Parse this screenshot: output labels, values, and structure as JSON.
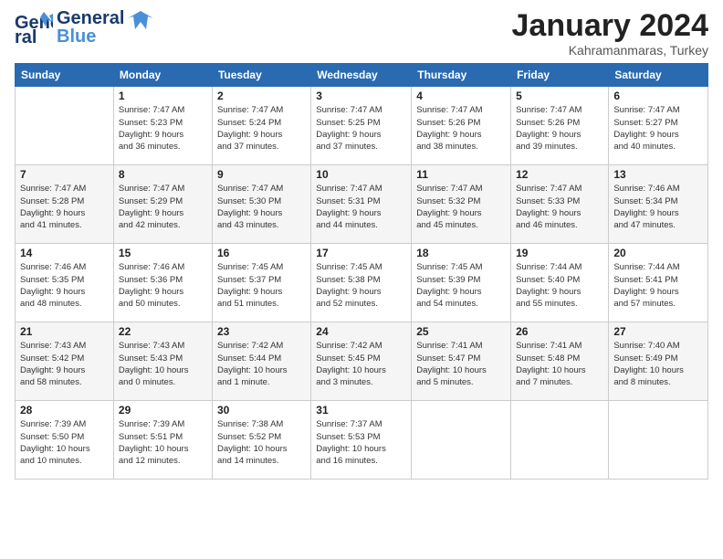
{
  "header": {
    "logo": {
      "general": "General",
      "blue": "Blue"
    },
    "title": "January 2024",
    "location": "Kahramanmaras, Turkey"
  },
  "weekdays": [
    "Sunday",
    "Monday",
    "Tuesday",
    "Wednesday",
    "Thursday",
    "Friday",
    "Saturday"
  ],
  "weeks": [
    [
      {
        "day": "",
        "info": ""
      },
      {
        "day": "1",
        "info": "Sunrise: 7:47 AM\nSunset: 5:23 PM\nDaylight: 9 hours\nand 36 minutes."
      },
      {
        "day": "2",
        "info": "Sunrise: 7:47 AM\nSunset: 5:24 PM\nDaylight: 9 hours\nand 37 minutes."
      },
      {
        "day": "3",
        "info": "Sunrise: 7:47 AM\nSunset: 5:25 PM\nDaylight: 9 hours\nand 37 minutes."
      },
      {
        "day": "4",
        "info": "Sunrise: 7:47 AM\nSunset: 5:26 PM\nDaylight: 9 hours\nand 38 minutes."
      },
      {
        "day": "5",
        "info": "Sunrise: 7:47 AM\nSunset: 5:26 PM\nDaylight: 9 hours\nand 39 minutes."
      },
      {
        "day": "6",
        "info": "Sunrise: 7:47 AM\nSunset: 5:27 PM\nDaylight: 9 hours\nand 40 minutes."
      }
    ],
    [
      {
        "day": "7",
        "info": "Sunrise: 7:47 AM\nSunset: 5:28 PM\nDaylight: 9 hours\nand 41 minutes."
      },
      {
        "day": "8",
        "info": "Sunrise: 7:47 AM\nSunset: 5:29 PM\nDaylight: 9 hours\nand 42 minutes."
      },
      {
        "day": "9",
        "info": "Sunrise: 7:47 AM\nSunset: 5:30 PM\nDaylight: 9 hours\nand 43 minutes."
      },
      {
        "day": "10",
        "info": "Sunrise: 7:47 AM\nSunset: 5:31 PM\nDaylight: 9 hours\nand 44 minutes."
      },
      {
        "day": "11",
        "info": "Sunrise: 7:47 AM\nSunset: 5:32 PM\nDaylight: 9 hours\nand 45 minutes."
      },
      {
        "day": "12",
        "info": "Sunrise: 7:47 AM\nSunset: 5:33 PM\nDaylight: 9 hours\nand 46 minutes."
      },
      {
        "day": "13",
        "info": "Sunrise: 7:46 AM\nSunset: 5:34 PM\nDaylight: 9 hours\nand 47 minutes."
      }
    ],
    [
      {
        "day": "14",
        "info": "Sunrise: 7:46 AM\nSunset: 5:35 PM\nDaylight: 9 hours\nand 48 minutes."
      },
      {
        "day": "15",
        "info": "Sunrise: 7:46 AM\nSunset: 5:36 PM\nDaylight: 9 hours\nand 50 minutes."
      },
      {
        "day": "16",
        "info": "Sunrise: 7:45 AM\nSunset: 5:37 PM\nDaylight: 9 hours\nand 51 minutes."
      },
      {
        "day": "17",
        "info": "Sunrise: 7:45 AM\nSunset: 5:38 PM\nDaylight: 9 hours\nand 52 minutes."
      },
      {
        "day": "18",
        "info": "Sunrise: 7:45 AM\nSunset: 5:39 PM\nDaylight: 9 hours\nand 54 minutes."
      },
      {
        "day": "19",
        "info": "Sunrise: 7:44 AM\nSunset: 5:40 PM\nDaylight: 9 hours\nand 55 minutes."
      },
      {
        "day": "20",
        "info": "Sunrise: 7:44 AM\nSunset: 5:41 PM\nDaylight: 9 hours\nand 57 minutes."
      }
    ],
    [
      {
        "day": "21",
        "info": "Sunrise: 7:43 AM\nSunset: 5:42 PM\nDaylight: 9 hours\nand 58 minutes."
      },
      {
        "day": "22",
        "info": "Sunrise: 7:43 AM\nSunset: 5:43 PM\nDaylight: 10 hours\nand 0 minutes."
      },
      {
        "day": "23",
        "info": "Sunrise: 7:42 AM\nSunset: 5:44 PM\nDaylight: 10 hours\nand 1 minute."
      },
      {
        "day": "24",
        "info": "Sunrise: 7:42 AM\nSunset: 5:45 PM\nDaylight: 10 hours\nand 3 minutes."
      },
      {
        "day": "25",
        "info": "Sunrise: 7:41 AM\nSunset: 5:47 PM\nDaylight: 10 hours\nand 5 minutes."
      },
      {
        "day": "26",
        "info": "Sunrise: 7:41 AM\nSunset: 5:48 PM\nDaylight: 10 hours\nand 7 minutes."
      },
      {
        "day": "27",
        "info": "Sunrise: 7:40 AM\nSunset: 5:49 PM\nDaylight: 10 hours\nand 8 minutes."
      }
    ],
    [
      {
        "day": "28",
        "info": "Sunrise: 7:39 AM\nSunset: 5:50 PM\nDaylight: 10 hours\nand 10 minutes."
      },
      {
        "day": "29",
        "info": "Sunrise: 7:39 AM\nSunset: 5:51 PM\nDaylight: 10 hours\nand 12 minutes."
      },
      {
        "day": "30",
        "info": "Sunrise: 7:38 AM\nSunset: 5:52 PM\nDaylight: 10 hours\nand 14 minutes."
      },
      {
        "day": "31",
        "info": "Sunrise: 7:37 AM\nSunset: 5:53 PM\nDaylight: 10 hours\nand 16 minutes."
      },
      {
        "day": "",
        "info": ""
      },
      {
        "day": "",
        "info": ""
      },
      {
        "day": "",
        "info": ""
      }
    ]
  ]
}
